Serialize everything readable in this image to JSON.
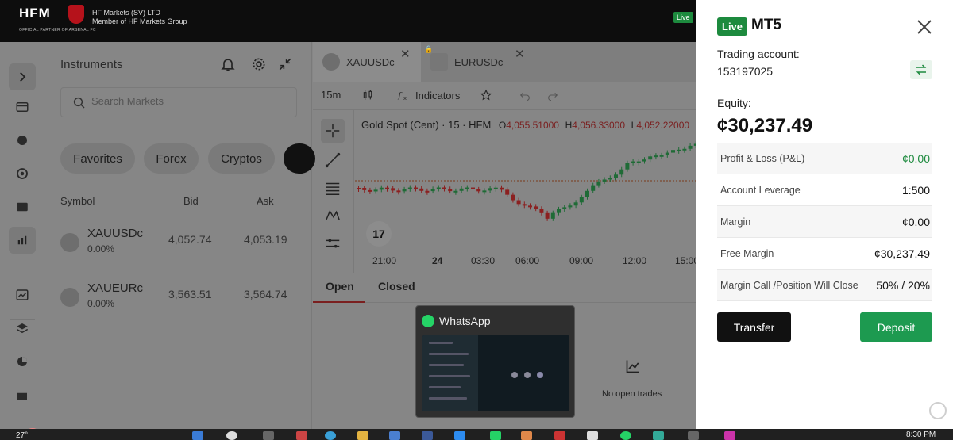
{
  "header": {
    "logo": "HFM",
    "logo_sub": "OFFICIAL PARTNER OF ARSENAL FC",
    "company_name": "HF Markets (SV) LTD",
    "company_group": "Member of HF Markets Group",
    "live_label": "Live"
  },
  "instruments": {
    "title": "Instruments",
    "search_placeholder": "Search Markets",
    "categories": [
      "Favorites",
      "Forex",
      "Cryptos"
    ],
    "columns": {
      "symbol": "Symbol",
      "bid": "Bid",
      "ask": "Ask"
    },
    "rows": [
      {
        "symbol": "XAUUSDc",
        "change": "0.00%",
        "bid": "4,052.74",
        "ask": "4,053.19"
      },
      {
        "symbol": "XAUEURc",
        "change": "0.00%",
        "bid": "3,563.51",
        "ask": "3,564.74"
      }
    ]
  },
  "chart_tabs": [
    {
      "label": "XAUUSDc"
    },
    {
      "label": "EURUSDc"
    }
  ],
  "chart_toolbar": {
    "timeframe": "15m",
    "indicators": "Indicators"
  },
  "chart_legend": {
    "title": "Gold Spot (Cent) · 15 · HFM",
    "o_label": "O",
    "o": "4,055.51000",
    "h_label": "H",
    "h": "4,056.33000",
    "l_label": "L",
    "l": "4,052.22000"
  },
  "chart_data": {
    "type": "candlestick",
    "x_ticks": [
      "21:00",
      "24",
      "03:30",
      "06:00",
      "09:00",
      "12:00",
      "15:00"
    ],
    "colors": {
      "up": "#1d8a3e",
      "down": "#b3261e"
    }
  },
  "tv_logo": "17",
  "bottom_tabs": {
    "open": "Open",
    "closed": "Closed"
  },
  "no_trades": "No open trades",
  "whatsapp_preview": {
    "title": "WhatsApp"
  },
  "taskbar": {
    "temp": "27°",
    "time": "8:30 PM"
  },
  "panel": {
    "live": "Live",
    "platform": "MT5",
    "trading_account_label": "Trading account:",
    "trading_account_number": "153197025",
    "equity_label": "Equity:",
    "equity_value": "¢30,237.49",
    "rows": [
      {
        "label": "Profit & Loss (P&L)",
        "value": "¢0.00"
      },
      {
        "label": "Account Leverage",
        "value": "1:500"
      },
      {
        "label": "Margin",
        "value": "¢0.00"
      },
      {
        "label": "Free Margin",
        "value": "¢30,237.49"
      },
      {
        "label": "Margin Call /Position Will Close",
        "value": "50% / 20%"
      }
    ],
    "transfer": "Transfer",
    "deposit": "Deposit"
  },
  "colors": {
    "accent_green": "#1d9a50",
    "live_green": "#1d8a3e",
    "pnl_green": "#1d8a3e"
  }
}
